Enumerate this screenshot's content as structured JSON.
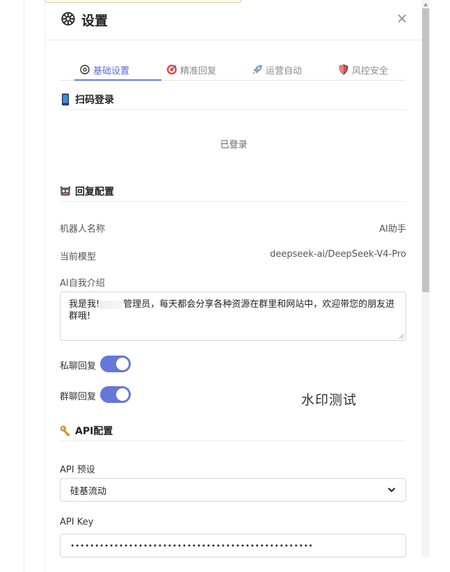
{
  "dialog": {
    "title": "设置",
    "close_label": "×"
  },
  "tabs": [
    {
      "label": "基础设置",
      "icon": "gear-icon",
      "active": true
    },
    {
      "label": "精准回复",
      "icon": "target-icon",
      "active": false
    },
    {
      "label": "运营自动",
      "icon": "rocket-icon",
      "active": false
    },
    {
      "label": "风控安全",
      "icon": "shield-icon",
      "active": false
    }
  ],
  "scan_login": {
    "title": "扫码登录",
    "status": "已登录"
  },
  "reply_config": {
    "title": "回复配置",
    "bot_name_label": "机器人名称",
    "bot_name_value": "AI助手",
    "model_label": "当前模型",
    "model_value": "deepseek-ai/DeepSeek-V4-Pro",
    "intro_label": "AI自我介绍",
    "intro_line1_a": "我是我!",
    "intro_line1_b": "管理员，每天都会分享各种资源在群里和网站中，欢迎带您的朋友进",
    "intro_line2": "群哦!",
    "private_reply_label": "私聊回复",
    "group_reply_label": "群聊回复",
    "private_reply_on": true,
    "group_reply_on": true
  },
  "watermark": "水印测试",
  "api_config": {
    "title": "API配置",
    "preset_label": "API 预设",
    "preset_value": "硅基流动",
    "key_label": "API Key",
    "key_value": "••••••••••••••••••••••••••••••••••••••••••••••••••"
  },
  "colors": {
    "accent": "#6577d9",
    "tab_active": "#5a6ad6"
  }
}
